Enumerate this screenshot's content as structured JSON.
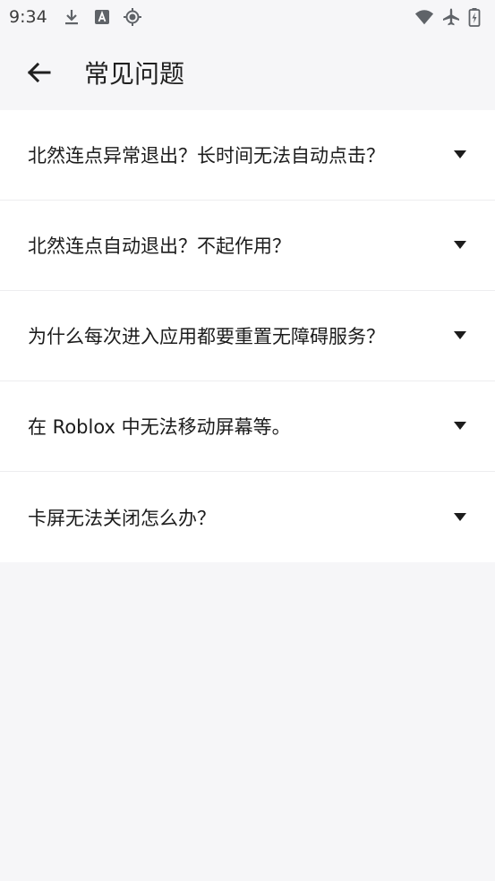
{
  "status_bar": {
    "time": "9:34",
    "icons_left": [
      "download-icon",
      "font-app-icon",
      "location-target-icon"
    ],
    "icons_right": [
      "wifi-icon",
      "airplane-mode-icon",
      "battery-charging-icon"
    ]
  },
  "app_bar": {
    "title": "常见问题",
    "back_icon": "arrow-left-icon"
  },
  "faq": {
    "items": [
      {
        "question": "北然连点异常退出？长时间无法自动点击？"
      },
      {
        "question": "北然连点自动退出？不起作用？"
      },
      {
        "question": "为什么每次进入应用都要重置无障碍服务？"
      },
      {
        "question": "在 Roblox 中无法移动屏幕等。"
      },
      {
        "question": "卡屏无法关闭怎么办？"
      }
    ],
    "expand_icon": "triangle-down-icon"
  },
  "colors": {
    "background": "#f6f6f8",
    "card": "#ffffff",
    "text": "#1c1c1c",
    "divider": "#ededef"
  }
}
